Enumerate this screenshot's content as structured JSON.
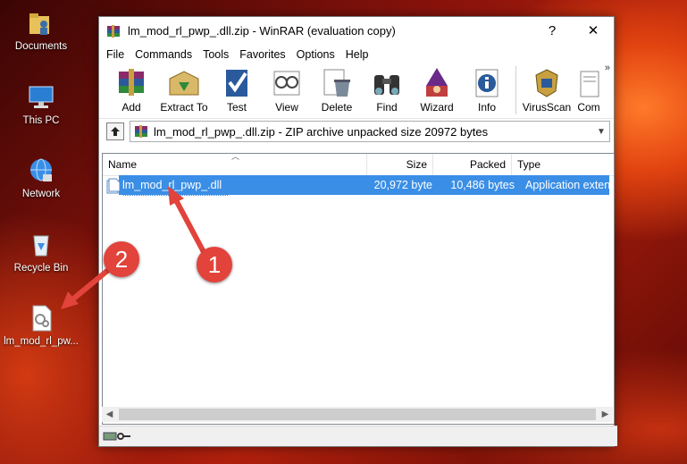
{
  "desktop": {
    "icons": [
      {
        "label": "Documents"
      },
      {
        "label": "This PC"
      },
      {
        "label": "Network"
      },
      {
        "label": "Recycle Bin"
      },
      {
        "label": "lm_mod_rl_pw..."
      }
    ]
  },
  "annotations": {
    "step1": "1",
    "step2": "2",
    "arrow_color": "#e2433b"
  },
  "window": {
    "title": "lm_mod_rl_pwp_.dll.zip - WinRAR (evaluation copy)",
    "help_btn": "?",
    "close_btn": "✕",
    "menu": [
      "File",
      "Commands",
      "Tools",
      "Favorites",
      "Options",
      "Help"
    ],
    "toolbar": [
      {
        "label": "Add",
        "icon": "add-archive-icon"
      },
      {
        "label": "Extract To",
        "icon": "extract-to-icon"
      },
      {
        "label": "Test",
        "icon": "test-icon"
      },
      {
        "label": "View",
        "icon": "view-icon"
      },
      {
        "label": "Delete",
        "icon": "delete-icon"
      },
      {
        "label": "Find",
        "icon": "find-icon"
      },
      {
        "label": "Wizard",
        "icon": "wizard-icon"
      },
      {
        "label": "Info",
        "icon": "info-icon"
      },
      {
        "label": "VirusScan",
        "icon": "virusscan-icon"
      },
      {
        "label": "Com",
        "icon": "comment-icon"
      }
    ],
    "toolbar_more": "»",
    "address": "lm_mod_rl_pwp_.dll.zip - ZIP archive unpacked size 20972 bytes",
    "columns": {
      "name": "Name",
      "size": "Size",
      "packed": "Packed",
      "type": "Type"
    },
    "files": [
      {
        "name": "lm_mod_rl_pwp_.dll",
        "size": "20,972 byte",
        "packed": "10,486 bytes",
        "type": "Application extens"
      }
    ],
    "selection_color": "#3a8ee6"
  }
}
